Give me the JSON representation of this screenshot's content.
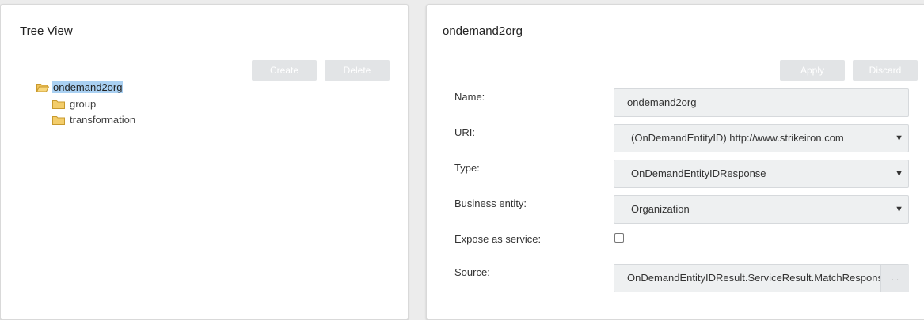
{
  "tree_panel": {
    "title": "Tree View",
    "create_label": "Create",
    "delete_label": "Delete",
    "root": "ondemand2org",
    "children": [
      "group",
      "transformation"
    ]
  },
  "detail_panel": {
    "title": "ondemand2org",
    "apply_label": "Apply",
    "discard_label": "Discard",
    "fields": {
      "name_label": "Name:",
      "name_value": "ondemand2org",
      "uri_label": "URI:",
      "uri_value": "(OnDemandEntityID) http://www.strikeiron.com",
      "type_label": "Type:",
      "type_value": "OnDemandEntityIDResponse",
      "business_entity_label": "Business entity:",
      "business_entity_value": "Organization",
      "expose_label": "Expose as service:",
      "expose_checked": false,
      "source_label": "Source:",
      "source_value": "OnDemandEntityIDResult.ServiceResult.MatchResponse.N",
      "source_button": "..."
    }
  },
  "icons": {
    "folder_open": "folder-open-icon",
    "folder_closed": "folder-icon",
    "caret": "chevron-down-icon"
  },
  "colors": {
    "selection": "#a9d0f2",
    "folder": "#f0c35a",
    "disabled_button": "#e2e4e6"
  }
}
